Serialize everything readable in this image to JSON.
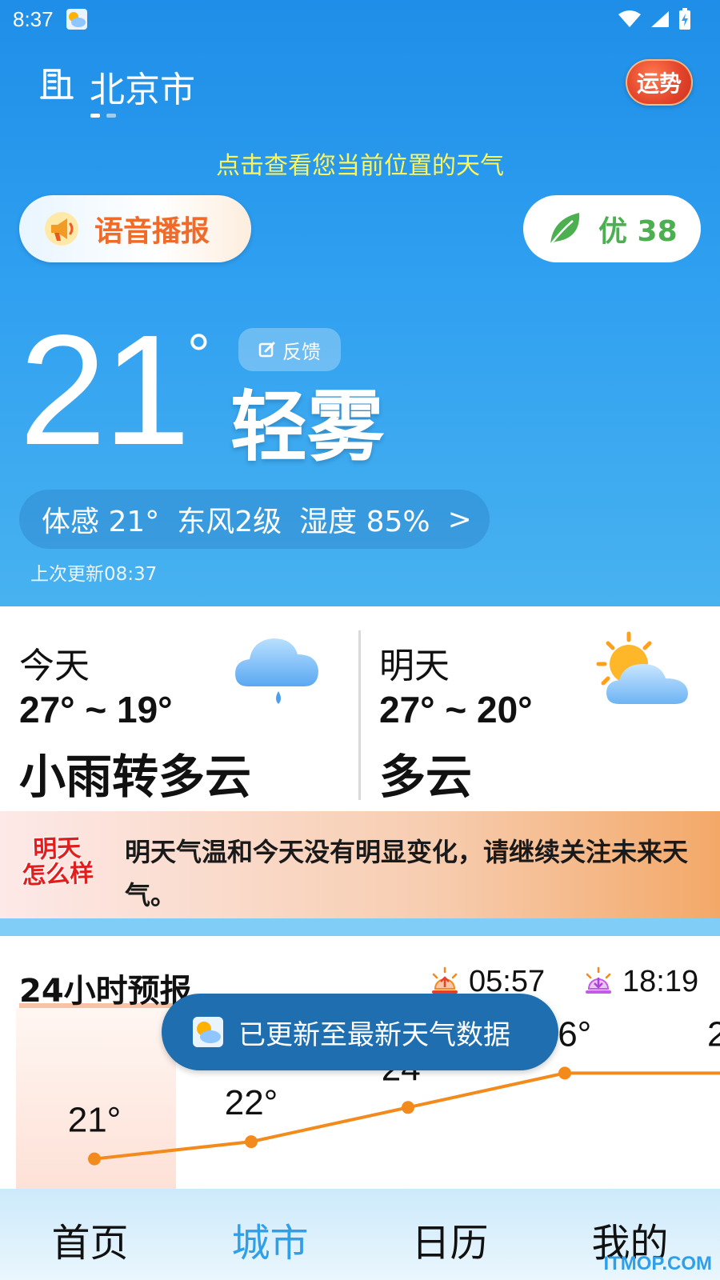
{
  "status_bar": {
    "time": "8:37"
  },
  "header": {
    "city": "北京市",
    "fortune_label": "运势"
  },
  "locate_tip": "点击查看您当前位置的天气",
  "voice_button": {
    "label": "语音播报"
  },
  "aqi": {
    "label": "优 38"
  },
  "current": {
    "temperature": "21",
    "degree_symbol": "°",
    "condition": "轻雾",
    "feedback_label": "反馈",
    "feels_like": "体感 21°",
    "wind": "东风2级",
    "humidity": "湿度 85%",
    "arrow": ">",
    "updated": "上次更新08:37"
  },
  "today": {
    "name": "今天",
    "range": "27° ~ 19°",
    "condition": "小雨转多云",
    "icon": "rain-cloud-icon"
  },
  "tomorrow": {
    "name": "明天",
    "range": "27° ~ 20°",
    "condition": "多云",
    "icon": "sun-cloud-icon"
  },
  "banner": {
    "badge_line1": "明天",
    "badge_line2": "怎么样",
    "text": "明天气温和今天没有明显变化，请继续关注未来天气。"
  },
  "hourly": {
    "title": "24小时预报",
    "sunrise": "05:57",
    "sunset": "18:19",
    "temps": [
      "21°",
      "22°",
      "24°",
      "26°",
      "2"
    ]
  },
  "chart_data": {
    "type": "line",
    "title": "24小时预报",
    "x": [
      0,
      1,
      2,
      3,
      4
    ],
    "values": [
      21,
      22,
      24,
      26,
      26
    ],
    "labels": [
      "21°",
      "22°",
      "24°",
      "26°",
      "2"
    ],
    "ylim": [
      20,
      27
    ],
    "color": "#f28a1c"
  },
  "toast": "已更新至最新天气数据",
  "nav": {
    "home": "首页",
    "city": "城市",
    "calendar": "日历",
    "mine": "我的"
  },
  "watermark": "ITMOP.COM",
  "colors": {
    "accent": "#2f9fe9",
    "voice": "#f06a2a",
    "aqi_green": "#4caf50",
    "locate_tip": "#fff45a"
  }
}
